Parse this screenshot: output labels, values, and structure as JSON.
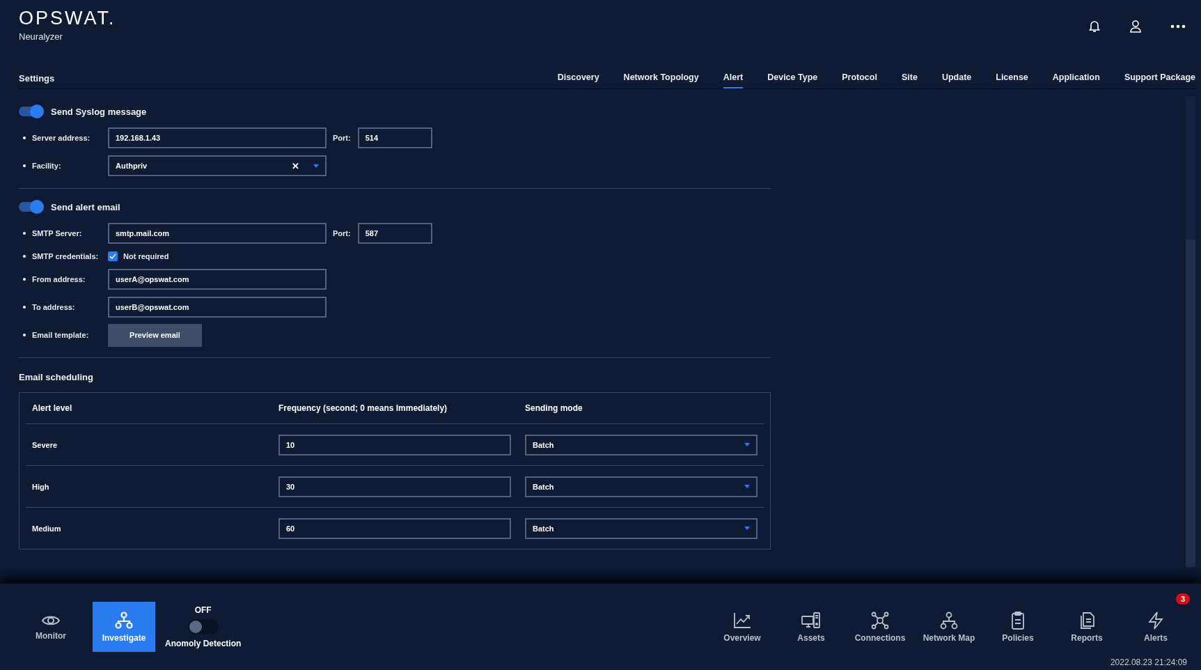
{
  "brand": {
    "logo": "OPSWAT.",
    "product": "Neuralyzer"
  },
  "settings_title": "Settings",
  "tabs": [
    {
      "label": "Discovery",
      "selected": false
    },
    {
      "label": "Network Topology",
      "selected": false
    },
    {
      "label": "Alert",
      "selected": true
    },
    {
      "label": "Device Type",
      "selected": false
    },
    {
      "label": "Protocol",
      "selected": false
    },
    {
      "label": "Site",
      "selected": false
    },
    {
      "label": "Update",
      "selected": false
    },
    {
      "label": "License",
      "selected": false
    },
    {
      "label": "Application",
      "selected": false
    },
    {
      "label": "Support Package",
      "selected": false
    }
  ],
  "syslog": {
    "label": "Send Syslog message",
    "on": true,
    "server_address": {
      "label": "Server address:",
      "value": "192.168.1.43"
    },
    "port": {
      "label": "Port:",
      "value": "514"
    },
    "facility": {
      "label": "Facility:",
      "value": "Authpriv",
      "clear": "✕"
    }
  },
  "email": {
    "label": "Send alert email",
    "on": true,
    "smtp_server": {
      "label": "SMTP Server:",
      "value": "smtp.mail.com"
    },
    "port": {
      "label": "Port:",
      "value": "587"
    },
    "credentials": {
      "label": "SMTP credentials:",
      "option": "Not required",
      "checked": true
    },
    "from_address": {
      "label": "From address:",
      "value": "userA@opswat.com"
    },
    "to_address": {
      "label": "To address:",
      "value": "userB@opswat.com"
    },
    "template": {
      "label": "Email template:",
      "button": "Preview email"
    }
  },
  "scheduling": {
    "title": "Email scheduling",
    "columns": [
      "Alert level",
      "Frequency (second; 0 means Immediately)",
      "Sending mode"
    ],
    "rows": [
      {
        "level": "Severe",
        "frequency": "10",
        "mode": "Batch"
      },
      {
        "level": "High",
        "frequency": "30",
        "mode": "Batch"
      },
      {
        "level": "Medium",
        "frequency": "60",
        "mode": "Batch"
      }
    ]
  },
  "bottom_nav": {
    "left": [
      {
        "label": "Monitor",
        "selected": false
      },
      {
        "label": "Investigate",
        "selected": true
      }
    ],
    "anomaly": {
      "state": "OFF",
      "on": false,
      "label": "Anomoly Detection"
    },
    "right": [
      {
        "label": "Overview"
      },
      {
        "label": "Assets"
      },
      {
        "label": "Connections"
      },
      {
        "label": "Network Map"
      },
      {
        "label": "Policies"
      },
      {
        "label": "Reports"
      },
      {
        "label": "Alerts",
        "badge": "3"
      }
    ],
    "timestamp": "2022.08.23 21:24:09"
  }
}
